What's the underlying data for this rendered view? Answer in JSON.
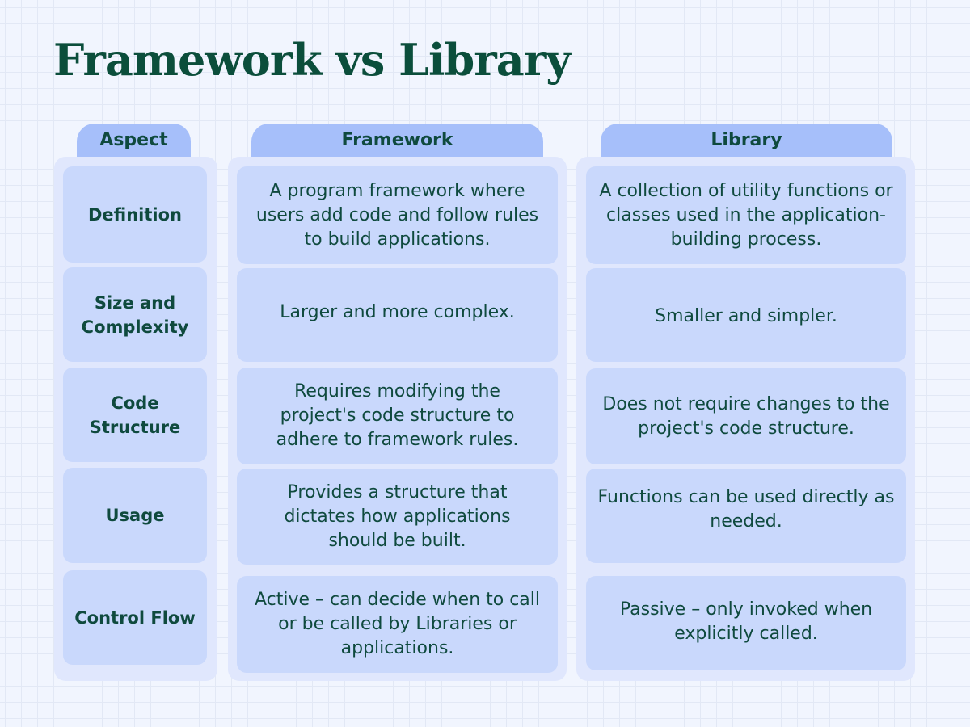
{
  "title": "Framework vs Library",
  "columns": {
    "aspect": "Aspect",
    "framework": "Framework",
    "library": "Library"
  },
  "rows": [
    {
      "aspect": "Definition",
      "framework": "A program framework where users add code and follow rules to build applications.",
      "library": "A collection of utility functions or classes used in the application-building process."
    },
    {
      "aspect": "Size and Complexity",
      "framework": "Larger and more complex.",
      "library": "Smaller and simpler."
    },
    {
      "aspect": "Code Structure",
      "framework": "Requires modifying the project's code structure to adhere to framework rules.",
      "library": "Does not require changes to the project's code structure."
    },
    {
      "aspect": "Usage",
      "framework": "Provides a structure that dictates how applications should be built.",
      "library": "Functions can be used directly as needed."
    },
    {
      "aspect": "Control Flow",
      "framework": "Active – can decide when to call or be called by Libraries or applications.",
      "library": "Passive – only invoked when explicitly called."
    }
  ],
  "colors": {
    "title": "#0b4e3b",
    "text": "#0f4a3e",
    "header_tab": "#a6bffa",
    "column_panel": "#e0e7fd",
    "cell": "#c9d8fc",
    "background": "#f1f5fe"
  }
}
